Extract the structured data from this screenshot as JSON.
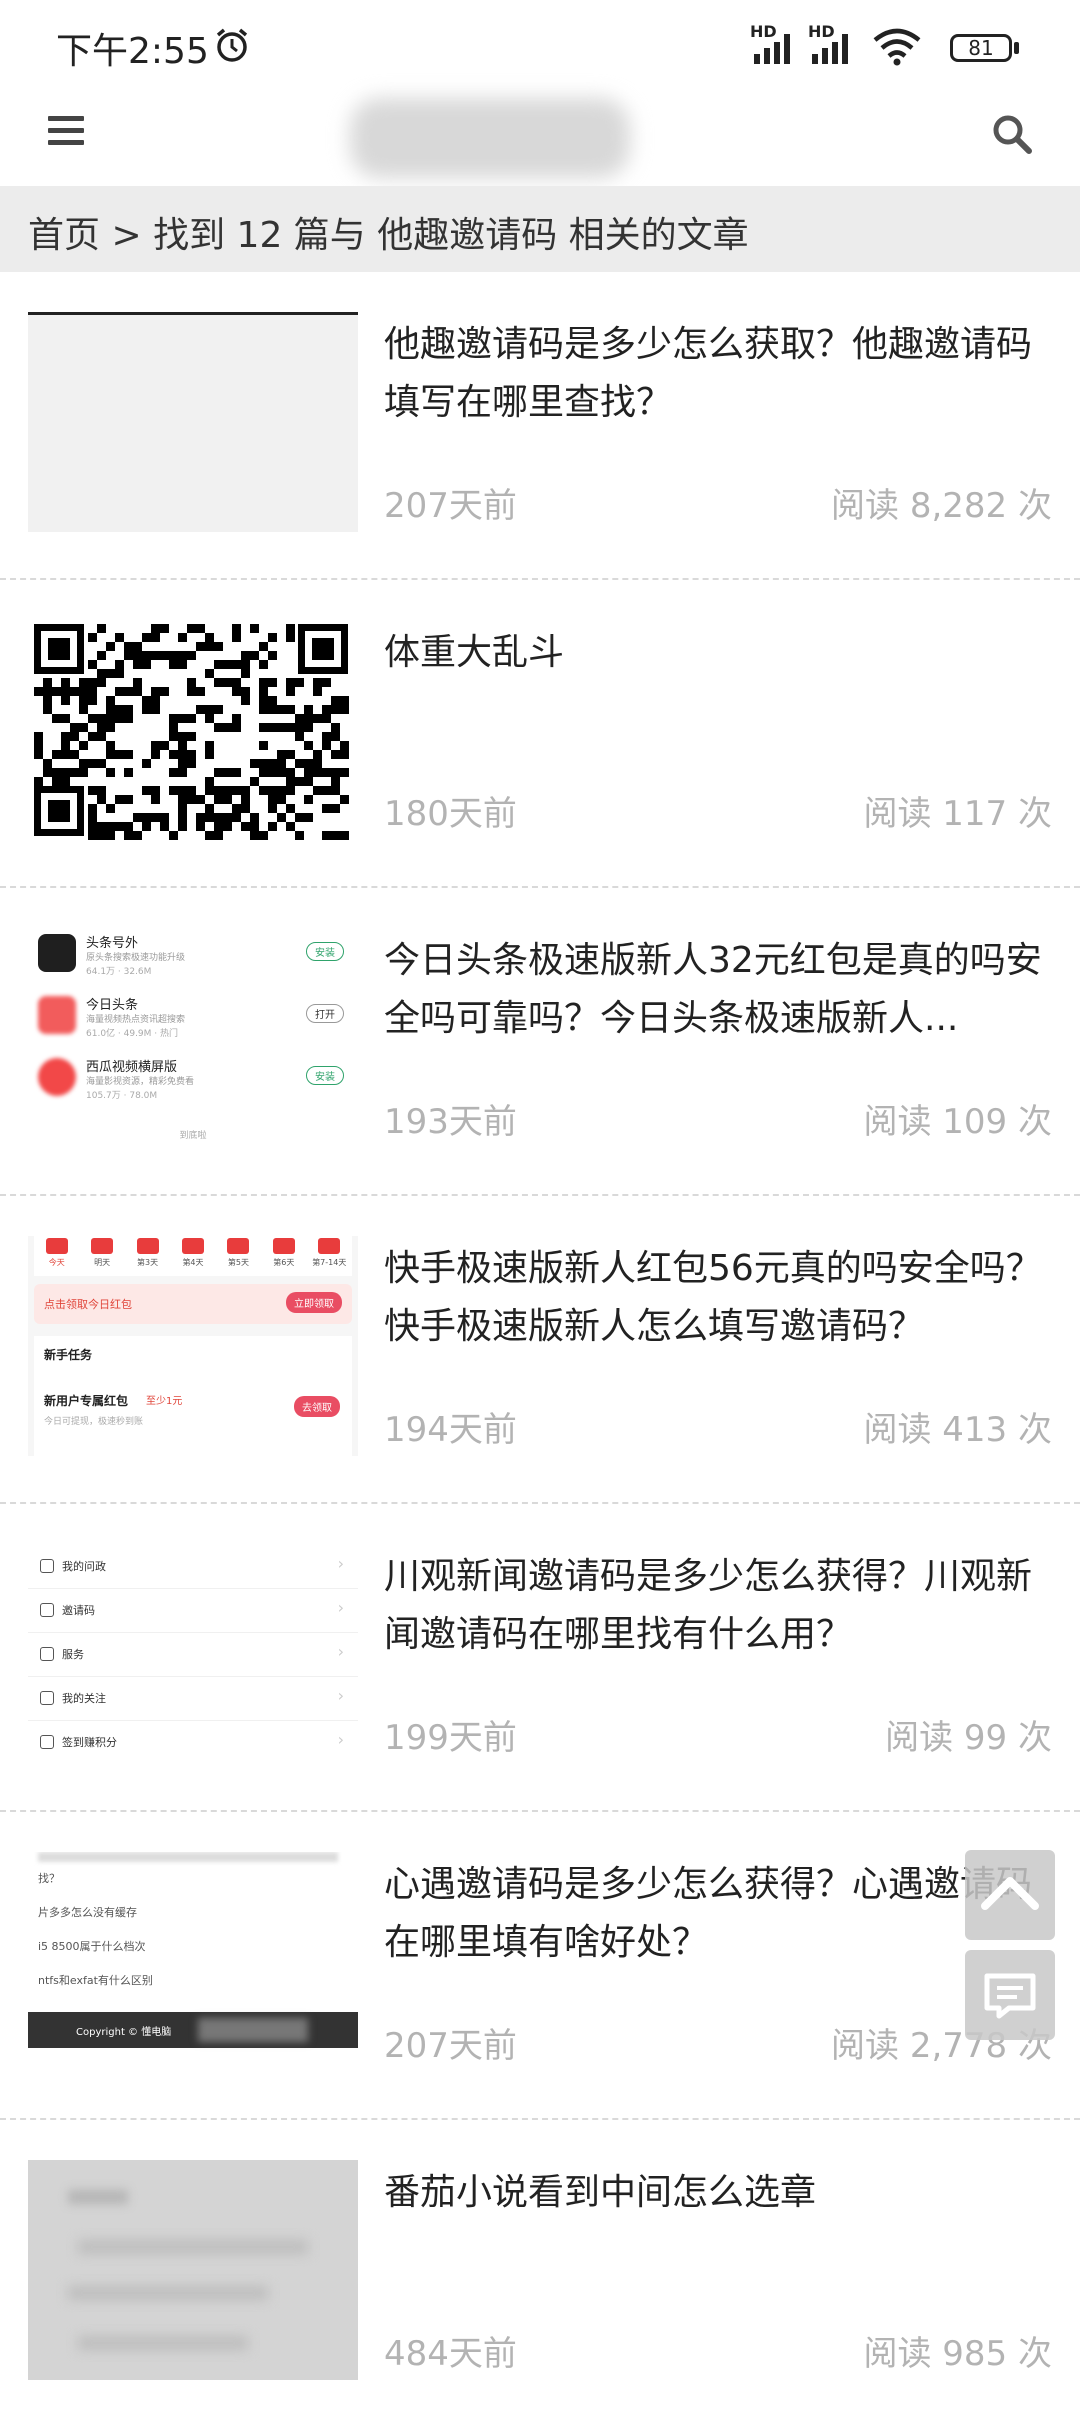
{
  "status_bar": {
    "time": "下午2:55",
    "network_1": "HD",
    "network_2": "HD",
    "battery": "81"
  },
  "breadcrumb": {
    "home": "首页",
    "separator": ">",
    "text": "找到 12 篇与 他趣邀请码 相关的文章"
  },
  "articles": [
    {
      "title": "他趣邀请码是多少怎么获取？他趣邀请码填写在哪里查找？",
      "date": "207天前",
      "reads": "阅读 8,282 次"
    },
    {
      "title": "体重大乱斗",
      "date": "180天前",
      "reads": "阅读 117 次"
    },
    {
      "title": "今日头条极速版新人32元红包是真的吗安全吗可靠吗？今日头条极速版新人...",
      "date": "193天前",
      "reads": "阅读 109 次"
    },
    {
      "title": "快手极速版新人红包56元真的吗安全吗？快手极速版新人怎么填写邀请码？",
      "date": "194天前",
      "reads": "阅读 413 次"
    },
    {
      "title": "川观新闻邀请码是多少怎么获得？川观新闻邀请码在哪里找有什么用？",
      "date": "199天前",
      "reads": "阅读 99 次"
    },
    {
      "title": "心遇邀请码是多少怎么获得？心遇邀请码在哪里填有啥好处？",
      "date": "207天前",
      "reads": "阅读 2,778 次"
    },
    {
      "title": "番茄小说看到中间怎么选章",
      "date": "484天前",
      "reads": "阅读 985 次"
    }
  ],
  "thumbnails": {
    "t3": {
      "rows": [
        {
          "name": "头条号外",
          "desc": "原头条搜索极速功能升级",
          "meta": "64.1万 · 32.6M",
          "btn": "安装"
        },
        {
          "name": "今日头条",
          "desc": "海量视频热点资讯超搜索",
          "meta": "61.0亿 · 49.9M · 热门",
          "btn": "打开"
        },
        {
          "name": "西瓜视频横屏版",
          "desc": "海量影视资源，精彩免费看",
          "meta": "105.7万 · 78.0M",
          "btn": "安装"
        }
      ],
      "footer": "到底啦"
    },
    "t4": {
      "days": [
        "今天",
        "明天",
        "第3天",
        "第4天",
        "第5天",
        "第6天",
        "第7-14天"
      ],
      "claim_text": "点击领取今日红包",
      "claim_btn": "立即领取",
      "task_header": "新手任务",
      "task_title": "新用户专属红包",
      "task_badge": "至少1元",
      "task_desc": "今日可提现，极速秒到账",
      "task_btn": "去领取"
    },
    "t5": {
      "menu": [
        "我的问政",
        "邀请码",
        "服务",
        "我的关注",
        "签到赚积分"
      ]
    },
    "t6": {
      "lines": [
        "找？",
        "片多多怎么没有缓存",
        "i5 8500属于什么档次",
        "ntfs和exfat有什么区别"
      ],
      "copyright": "Copyright © 懂电脑"
    }
  }
}
